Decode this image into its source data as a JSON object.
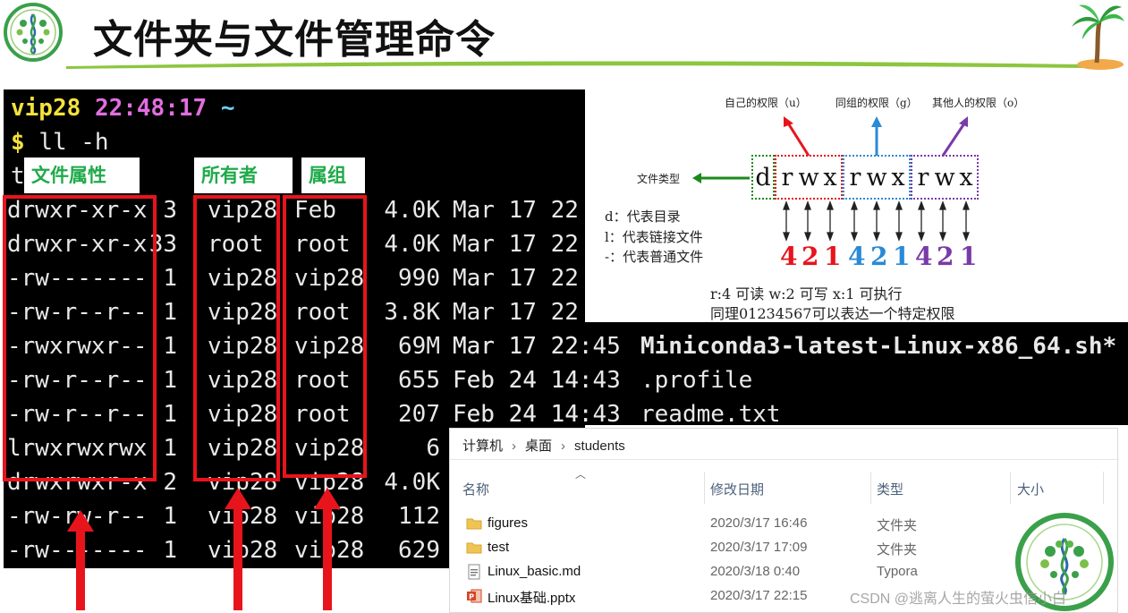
{
  "header": {
    "title": "文件夹与文件管理命令"
  },
  "terminal": {
    "prompt_user": "vip28",
    "prompt_time": "22:48:17",
    "prompt_tilde": "~",
    "prompt_symbol": "$",
    "command": "ll -h",
    "total_partial": "t",
    "labels": {
      "perm": "文件属性",
      "owner": "所有者",
      "group": "属组"
    },
    "rows": [
      {
        "perm": "drwxr-xr-x",
        "links": "3",
        "owner": "vip28",
        "group": "Feb",
        "size": "4.0K",
        "date": "Mar 17 22",
        "name": ""
      },
      {
        "perm": "drwxr-xr-x",
        "links": "33",
        "owner": "root",
        "group": "root",
        "size": "4.0K",
        "date": "Mar 17 22",
        "name": ""
      },
      {
        "perm": "-rw-------",
        "links": "1",
        "owner": "vip28",
        "group": "vip28",
        "size": "990",
        "date": "Mar 17 22",
        "name": ""
      },
      {
        "perm": "-rw-r--r--",
        "links": "1",
        "owner": "vip28",
        "group": "root",
        "size": "3.8K",
        "date": "Mar 17 22",
        "name": ""
      },
      {
        "perm": "-rwxrwxr--",
        "links": "1",
        "owner": "vip28",
        "group": "vip28",
        "size": "69M",
        "date": "Mar 17 22:45",
        "name": "Miniconda3-latest-Linux-x86_64.sh*"
      },
      {
        "perm": "-rw-r--r--",
        "links": "1",
        "owner": "vip28",
        "group": "root",
        "size": "655",
        "date": "Feb 24 14:43",
        "name": ".profile"
      },
      {
        "perm": "-rw-r--r--",
        "links": "1",
        "owner": "vip28",
        "group": "root",
        "size": "207",
        "date": "Feb 24 14:43",
        "name": "readme.txt"
      },
      {
        "perm": "lrwxrwxrwx",
        "links": "1",
        "owner": "vip28",
        "group": "vip28",
        "size": "6",
        "date": "",
        "name": ""
      },
      {
        "perm": "drwxrwxr-x",
        "links": "2",
        "owner": "vip28",
        "group": "vip28",
        "size": "4.0K",
        "date": "",
        "name": ""
      },
      {
        "perm": "-rw-rw-r--",
        "links": "1",
        "owner": "vip28",
        "group": "vip28",
        "size": "112",
        "date": "",
        "name": ""
      },
      {
        "perm": "-rw-------",
        "links": "1",
        "owner": "vip28",
        "group": "vip28",
        "size": "629",
        "date": "",
        "name": ""
      }
    ]
  },
  "permissions": {
    "self_label": "自己的权限（u）",
    "group_label": "同组的权限（g）",
    "other_label": "其他人的权限（o）",
    "file_type_label": "文件类型",
    "type_char": "d",
    "triplets": [
      [
        "r",
        "w",
        "x"
      ],
      [
        "r",
        "w",
        "x"
      ],
      [
        "r",
        "w",
        "x"
      ]
    ],
    "legend": [
      "d：代表目录",
      "l：代表链接文件",
      "-：代表普通文件"
    ],
    "numbers": [
      "4",
      "2",
      "1",
      "4",
      "2",
      "1",
      "4",
      "2",
      "1"
    ],
    "colors": {
      "u": "#e8141c",
      "g": "#2a8ad6",
      "o": "#7a3aa8",
      "type": "#1a8a1a"
    },
    "rwx_values": "r:4  可读      w:2  可写    x:1  可执行",
    "summary": "同理01234567可以表达一个特定权限"
  },
  "explorer": {
    "breadcrumb": [
      "计算机",
      "桌面",
      "students"
    ],
    "columns": {
      "name": "名称",
      "date": "修改日期",
      "type": "类型",
      "size": "大小"
    },
    "files": [
      {
        "name": "figures",
        "date": "2020/3/17 16:46",
        "type": "文件夹",
        "icon": "folder-icon"
      },
      {
        "name": "test",
        "date": "2020/3/17 17:09",
        "type": "文件夹",
        "icon": "folder-icon"
      },
      {
        "name": "Linux_basic.md",
        "date": "2020/3/18 0:40",
        "type": "Typora",
        "icon": "markdown-file-icon"
      },
      {
        "name": "Linux基础.pptx",
        "date": "2020/3/17 22:15",
        "type": "",
        "icon": "powerpoint-file-icon"
      }
    ]
  },
  "watermark": "CSDN @逃离人生的萤火虫信小白",
  "accent_red": "#e8141c",
  "label_green": "#1faa4a"
}
